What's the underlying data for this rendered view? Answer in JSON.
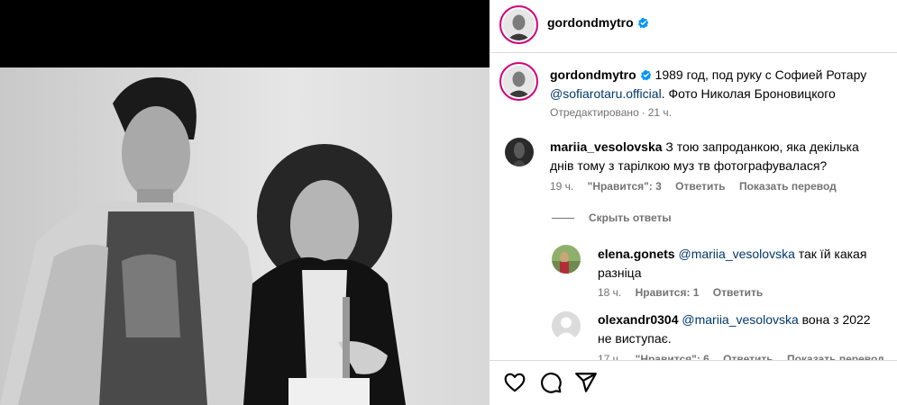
{
  "post": {
    "author": "gordondmytro",
    "caption_text": "1989 год, под руку с Софией Ротару",
    "caption_mention": "@sofiarotaru.official",
    "caption_suffix": ". Фото Николая Броновицкого",
    "edited_label": "Отредактировано",
    "edited_time": "21 ч."
  },
  "comments": [
    {
      "user": "mariia_vesolovska",
      "text": "З тою запроданкою, яка декілька днів тому з тарілкою муз тв фотографувалася?",
      "time": "19 ч.",
      "likes": "\"Нравится\": 3",
      "reply": "Ответить",
      "translate": "Показать перевод"
    }
  ],
  "hide_replies": "Скрыть ответы",
  "replies": [
    {
      "user": "elena.gonets",
      "mention": "@mariia_vesolovska",
      "text": "так їй какая разніца",
      "time": "18 ч.",
      "likes": "Нравится: 1",
      "reply": "Ответить"
    },
    {
      "user": "olexandr0304",
      "mention": "@mariia_vesolovska",
      "text": "вона з 2022 не виступає.",
      "time": "17 ч.",
      "likes": "\"Нравится\": 6",
      "reply": "Ответить",
      "translate": "Показать перевод"
    }
  ],
  "colors": {
    "mention": "#00376b",
    "verified": "#0095f6",
    "story_ring": "#d3007a",
    "meta": "#737373"
  },
  "icons": [
    "heart-icon",
    "comment-icon",
    "share-icon",
    "verified-icon"
  ]
}
